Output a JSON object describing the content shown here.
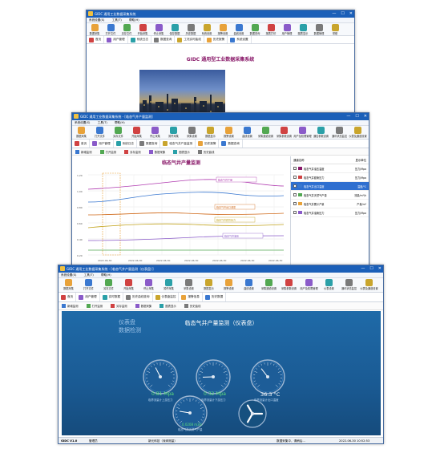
{
  "window1": {
    "title": "GIDC 通用工业数据采集系统",
    "menu": [
      "系统设置(S)",
      "工具(T)",
      "帮助(H)"
    ],
    "toolbar": [
      "数据采集",
      "打开文件",
      "另存文件",
      "开始采集",
      "停止采集",
      "保存数据",
      "历史数据",
      "系统设置",
      "报警设置",
      "曲线设置",
      "数据查询",
      "报表打印",
      "用户管理",
      "图表显示",
      "数据管理",
      "帮助"
    ],
    "tabs": [
      "首页",
      "用户管理",
      "系统日志",
      "数据查询",
      "工况实时曲线",
      "历史报警",
      "系统设置"
    ],
    "banner": "GIDC 通用型工业数据采集系统"
  },
  "window2": {
    "title": "GIDC 通用工业数据采集系统 - [临态气井产量监测]",
    "menu": [
      "系统设置(S)",
      "工具(T)",
      "帮助(H)"
    ],
    "toolbar": [
      "数据采集",
      "打开文件",
      "另存文件",
      "开始采集",
      "停止采集",
      "暂停采集",
      "采集设置",
      "数据显示",
      "报警设置",
      "曲线设置",
      "采集通道设置",
      "采集参数设置",
      "用户及权限管理",
      "通信参数设置",
      "通讯状态监控",
      "仪表及通道设置"
    ],
    "tabs": [
      "首页",
      "用户管理",
      "系统日志",
      "数据查询",
      "临态气井产量监测",
      "历史报警",
      "数据查询"
    ],
    "subbar": [
      "新增监测",
      "打开监测",
      "另存监测",
      "数据采集",
      "图表显示",
      "历史曲线"
    ],
    "chart_title": "临态气井产量监测",
    "channel_header": [
      "通道名称",
      "显示单位"
    ],
    "channels": [
      {
        "name": "临态气井油压温度",
        "unit": "压力/Mpa"
      },
      {
        "name": "临态气井套管压力",
        "unit": "压力/Mpa"
      },
      {
        "name": "临态气井出口温度",
        "unit": "温度/℃"
      },
      {
        "name": "临态气井天然气产量",
        "unit": "流量/m³/h"
      },
      {
        "name": "临态气井累计产量",
        "unit": "产量/m³"
      },
      {
        "name": "临态气井油管压力",
        "unit": "压力/Mpa"
      }
    ]
  },
  "window3": {
    "title": "GIDC 通用工业数据采集系统 - [临态气井产量监测（仪表盘）]",
    "menu": [
      "系统设置(S)",
      "工具(T)",
      "帮助(H)"
    ],
    "toolbar": [
      "数据采集",
      "打开文件",
      "另存文件",
      "开始采集",
      "停止采集",
      "暂停采集",
      "采集设置",
      "数据显示",
      "报警设置",
      "曲线设置",
      "采集通道设置",
      "采集参数设置",
      "用户及权限管理",
      "仪表设置",
      "通讯状态监控",
      "仪表及通道设置"
    ],
    "tabs": [
      "首页",
      "用户管理",
      "实时数据",
      "历史曲线查询",
      "仪表盘监控",
      "报警信息",
      "历史数据"
    ],
    "subbar": [
      "新增监测",
      "打开监测",
      "另存监测",
      "数据采集",
      "图表显示",
      "历史曲线"
    ],
    "panel_tag1": "仪表盘",
    "panel_tag2": "数据检测",
    "dash_title": "临态气井产量监测（仪表盘）",
    "gauges": [
      {
        "value": "0.81 Mpa",
        "label": "临界流量计上游压力"
      },
      {
        "value": "0.32 Mpa",
        "label": "临界流量计下游压力"
      },
      {
        "value": "36.3 °C",
        "label": "临界流量计出口温度"
      },
      {
        "value": "0.0208 m3/s",
        "label": "临态气井天然气产量"
      }
    ],
    "status": {
      "version": "GIDC V1.0",
      "user": "管理员",
      "org": "新元科技（深圳测量）",
      "collect": "数据采集中，请稍后...",
      "time": "2022-06-30 10:52:53"
    }
  }
}
